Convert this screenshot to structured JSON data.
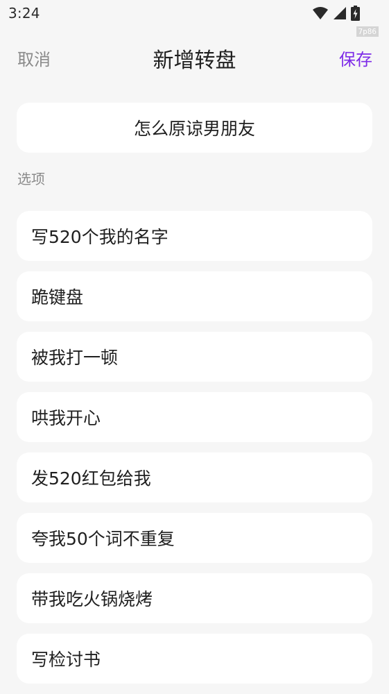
{
  "status_bar": {
    "time": "3:24",
    "icons": [
      "wifi-icon",
      "signal-icon",
      "battery-charging-icon"
    ],
    "badge": "7p86"
  },
  "header": {
    "cancel_label": "取消",
    "title": "新增转盘",
    "save_label": "保存"
  },
  "wheel": {
    "title_value": "怎么原谅男朋友"
  },
  "options_section": {
    "label": "选项",
    "items": [
      "写520个我的名字",
      "跪键盘",
      "被我打一顿",
      "哄我开心",
      "发520红包给我",
      "夸我50个词不重复",
      "带我吃火锅烧烤",
      "写检讨书"
    ]
  },
  "colors": {
    "background": "#f6f6f6",
    "card": "#ffffff",
    "accent": "#7d2be8",
    "muted_text": "#8a8a8a",
    "text": "#1f1f1f"
  }
}
